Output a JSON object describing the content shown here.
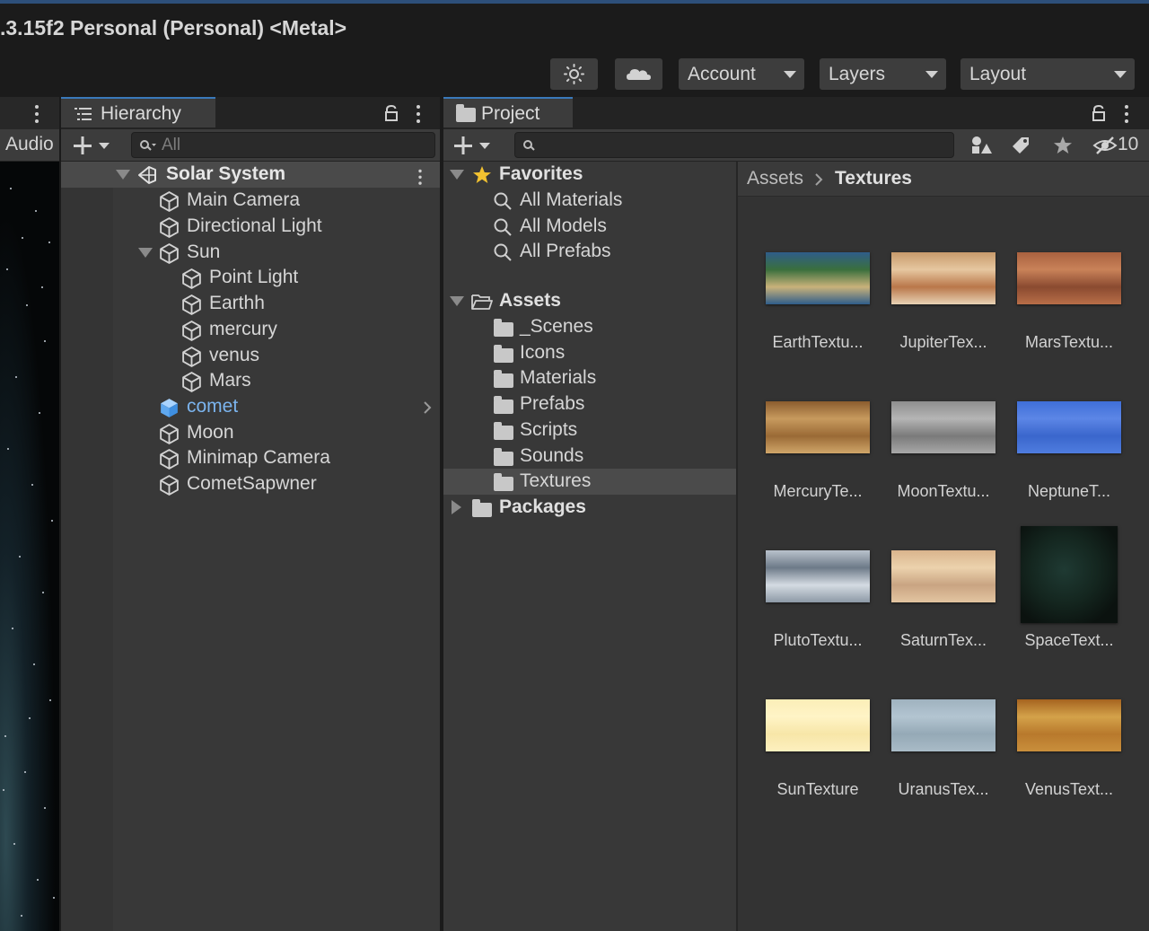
{
  "window": {
    "title": ".3.15f2 Personal (Personal) <Metal>"
  },
  "toolbar": {
    "buttons": [
      {
        "icon": "sun-gear-icon"
      },
      {
        "icon": "cloud-icon"
      }
    ],
    "dropdowns": [
      {
        "label": "Account"
      },
      {
        "label": "Layers"
      },
      {
        "label": "Layout"
      }
    ]
  },
  "scene_panel": {
    "tab_label": "Audio"
  },
  "hierarchy": {
    "tab_label": "Hierarchy",
    "search_placeholder": "All",
    "root": "Solar System",
    "items": [
      {
        "label": "Main Camera",
        "depth": 1
      },
      {
        "label": "Directional Light",
        "depth": 1
      },
      {
        "label": "Sun",
        "depth": 1,
        "expanded": true
      },
      {
        "label": "Point Light",
        "depth": 2
      },
      {
        "label": "Earthh",
        "depth": 2
      },
      {
        "label": "mercury",
        "depth": 2
      },
      {
        "label": "venus",
        "depth": 2
      },
      {
        "label": "Mars",
        "depth": 2
      },
      {
        "label": "comet",
        "depth": 1,
        "prefab": true
      },
      {
        "label": "Moon",
        "depth": 1
      },
      {
        "label": "Minimap Camera",
        "depth": 1
      },
      {
        "label": "CometSapwner",
        "depth": 1
      }
    ]
  },
  "project": {
    "tab_label": "Project",
    "hidden_count": "10",
    "favorites": {
      "label": "Favorites",
      "items": [
        "All Materials",
        "All Models",
        "All Prefabs"
      ]
    },
    "assets": {
      "label": "Assets",
      "folders": [
        "_Scenes",
        "Icons",
        "Materials",
        "Prefabs",
        "Scripts",
        "Sounds",
        "Textures"
      ],
      "selected": "Textures"
    },
    "packages": {
      "label": "Packages"
    },
    "breadcrumb": [
      "Assets",
      "Textures"
    ],
    "textures": [
      {
        "label": "EarthTextu...",
        "colors": [
          "#2f5d8a",
          "#3a6f3d",
          "#c9b27a",
          "#2f5d8a"
        ]
      },
      {
        "label": "JupiterTex...",
        "colors": [
          "#c79a6b",
          "#e6c7a0",
          "#b9774a",
          "#e8d2b4"
        ]
      },
      {
        "label": "MarsTextu...",
        "colors": [
          "#a9613f",
          "#c98259",
          "#8a4a30",
          "#b86e48"
        ]
      },
      {
        "label": "MercuryTe...",
        "colors": [
          "#8b5c2e",
          "#c79a5e",
          "#9a6a36",
          "#d0a669"
        ]
      },
      {
        "label": "MoonTextu...",
        "colors": [
          "#8e8e8e",
          "#b5b5b5",
          "#7a7a7a",
          "#a8a8a8"
        ]
      },
      {
        "label": "NeptuneT...",
        "colors": [
          "#3f6fd8",
          "#5c86e6",
          "#3a66cc",
          "#4f7ddf"
        ]
      },
      {
        "label": "PlutoTextu...",
        "colors": [
          "#b9c2cc",
          "#6d7a88",
          "#d4dbe2",
          "#8d99a6"
        ]
      },
      {
        "label": "SaturnTex...",
        "colors": [
          "#d9b48c",
          "#ecd2ad",
          "#c9a482",
          "#e3c5a1"
        ]
      },
      {
        "label": "SpaceText...",
        "colors": [
          "#0b120f",
          "#1f3a33",
          "#0d1512",
          "#14261f"
        ]
      },
      {
        "label": "SunTexture",
        "colors": [
          "#fbeeb8",
          "#fff4c6",
          "#f7e6a8",
          "#fdf0bf"
        ]
      },
      {
        "label": "UranusTex...",
        "colors": [
          "#9fb2bf",
          "#b3c5d1",
          "#95a9b6",
          "#a9bbc7"
        ]
      },
      {
        "label": "VenusText...",
        "colors": [
          "#a5631f",
          "#d4a24a",
          "#b8792c",
          "#c98f3c"
        ]
      }
    ]
  },
  "colors": {
    "accent": "#3a79bb",
    "prefab_text": "#7bb4ee",
    "favorite_star": "#f2c230"
  }
}
